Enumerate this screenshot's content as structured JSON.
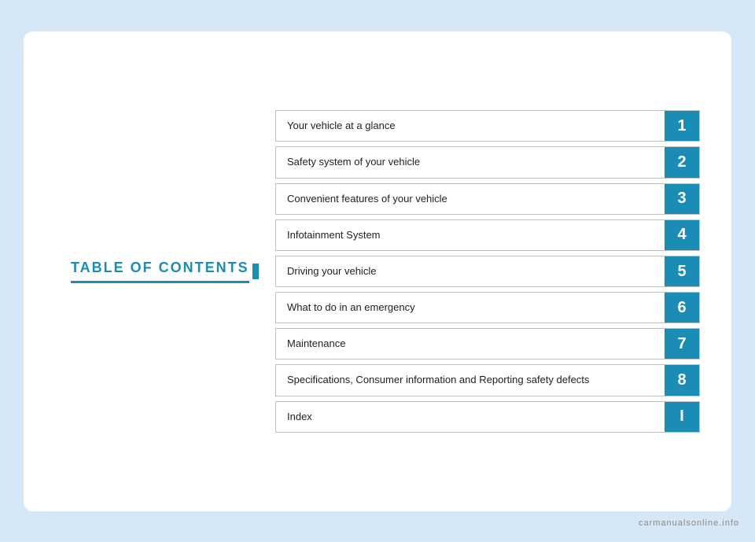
{
  "page": {
    "background_color": "#d6e8f5",
    "watermark": "carmanualsonline.info"
  },
  "left": {
    "title": "TABLE OF CONTENTS"
  },
  "toc": {
    "items": [
      {
        "label": "Your vehicle at a glance",
        "number": "1"
      },
      {
        "label": "Safety system of your vehicle",
        "number": "2"
      },
      {
        "label": "Convenient features of your vehicle",
        "number": "3"
      },
      {
        "label": "Infotainment System",
        "number": "4"
      },
      {
        "label": "Driving your vehicle",
        "number": "5"
      },
      {
        "label": "What to do in an emergency",
        "number": "6"
      },
      {
        "label": "Maintenance",
        "number": "7"
      },
      {
        "label": "Specifications, Consumer information and Reporting safety defects",
        "number": "8"
      },
      {
        "label": "Index",
        "number": "I"
      }
    ]
  }
}
